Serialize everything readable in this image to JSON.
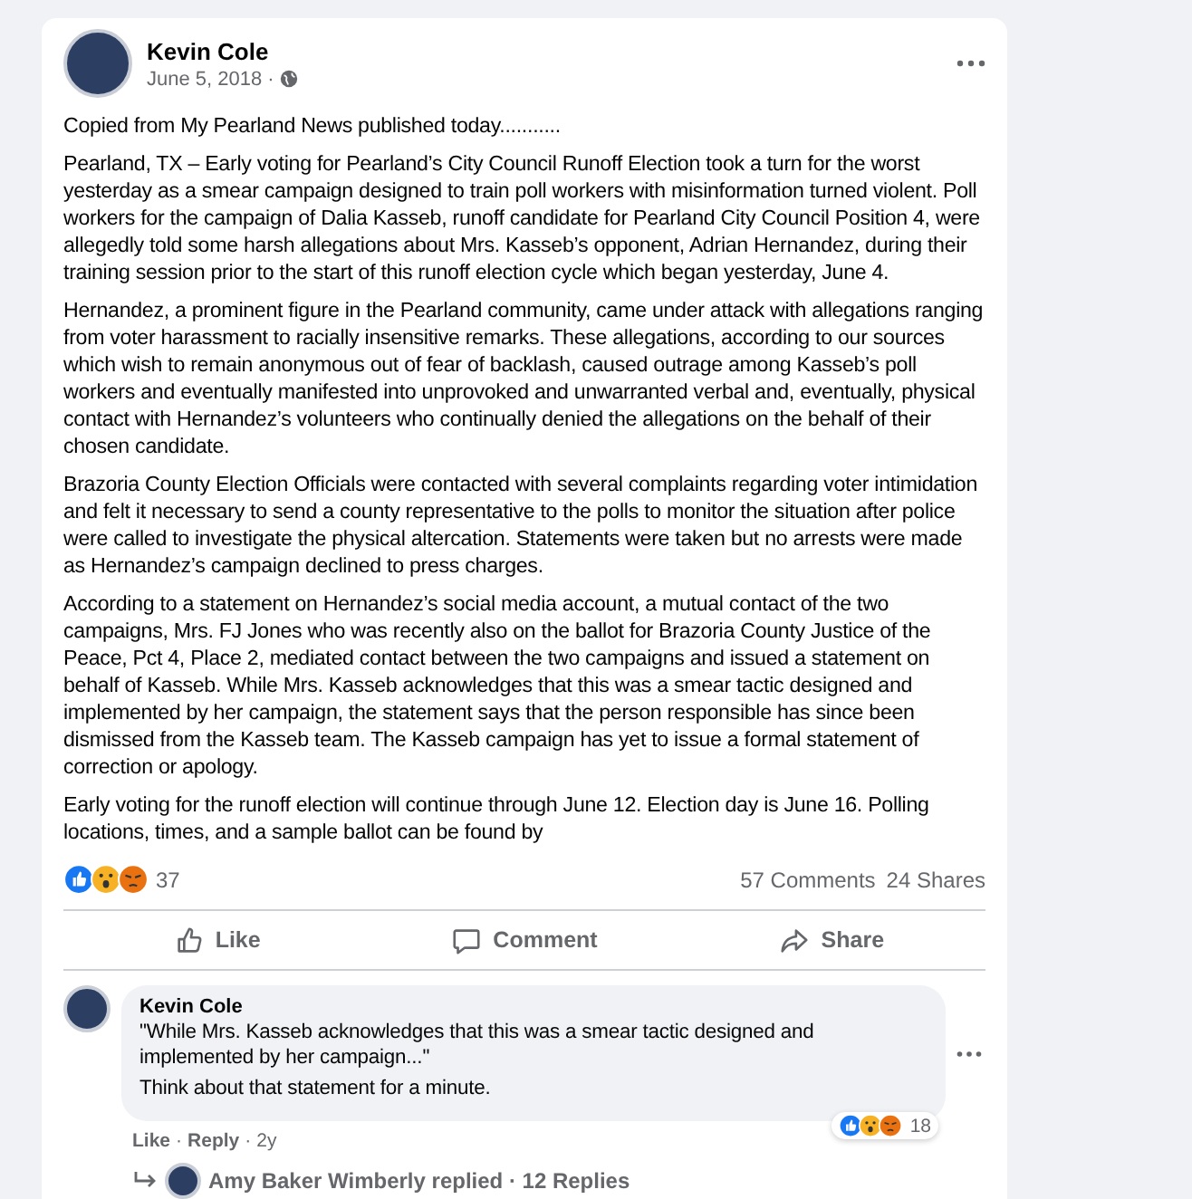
{
  "post": {
    "author": "Kevin Cole",
    "date": "June 5, 2018 ·",
    "paragraphs": [
      "Copied from My Pearland News published today...........",
      "Pearland, TX – Early voting for Pearland’s City Council Runoff Election took a turn for the worst yesterday as a smear campaign designed to train poll workers with misinformation turned violent. Poll workers for the campaign of Dalia Kasseb, runoff candidate for Pearland City Council Position 4, were allegedly told some harsh allegations about Mrs. Kasseb’s opponent, Adrian Hernandez, during their training session prior to the start of this runoff election cycle which began yesterday, June 4.",
      "Hernandez, a prominent figure in the Pearland community, came under attack with allegations ranging from voter harassment to racially insensitive remarks. These allegations, according to our sources which wish to remain anonymous out of fear of backlash, caused outrage among Kasseb’s poll workers and eventually manifested into unprovoked and unwarranted verbal and, eventually, physical contact with Hernandez’s volunteers who continually denied the allegations on the behalf of their chosen candidate.",
      "Brazoria County Election Officials were contacted with several complaints regarding voter intimidation and felt it necessary to send a county representative to the polls to monitor the situation after police were called to investigate the physical altercation. Statements were taken but no arrests were made as Hernandez’s campaign declined to press charges.",
      "According to a statement on Hernandez’s social media account, a mutual contact of the two campaigns, Mrs. FJ Jones who was recently also on the ballot for Brazoria County Justice of the Peace, Pct 4, Place 2, mediated contact between the two campaigns and issued a statement on behalf of Kasseb. While Mrs. Kasseb acknowledges that this was a smear tactic designed and implemented by her campaign, the statement says that the person responsible has since been dismissed from the Kasseb team. The Kasseb campaign has yet to issue a formal statement of correction or apology.",
      "Early voting for the runoff election will continue through June 12. Election day is June 16. Polling locations, times, and a sample ballot can be found by"
    ],
    "reactions": [
      {
        "kind": "like"
      },
      {
        "kind": "wow"
      },
      {
        "kind": "angry"
      }
    ],
    "reaction_count": "37",
    "comments": "57 Comments",
    "shares": "24 Shares",
    "actions": [
      {
        "kind": "like",
        "label": "Like"
      },
      {
        "kind": "comment",
        "label": "Comment"
      },
      {
        "kind": "share",
        "label": "Share"
      }
    ]
  },
  "comment": {
    "author": "Kevin Cole",
    "lines": [
      "\"While Mrs. Kasseb acknowledges that this was a smear tactic designed and implemented by her campaign...\"",
      "Think about that statement for a minute."
    ],
    "reactions": [
      {
        "kind": "like"
      },
      {
        "kind": "wow"
      },
      {
        "kind": "angry"
      }
    ],
    "reaction_count": "18",
    "like": "Like",
    "separators": [
      "·",
      "·"
    ],
    "reply": "Reply",
    "age": "2y"
  },
  "replies": {
    "text": "Amy Baker Wimberly replied · 12 Replies"
  }
}
